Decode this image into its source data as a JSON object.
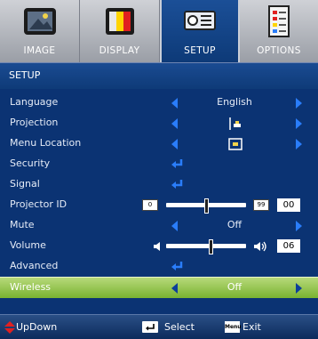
{
  "tabs": [
    {
      "label": "IMAGE",
      "icon": "image-icon"
    },
    {
      "label": "DISPLAY",
      "icon": "display-icon"
    },
    {
      "label": "SETUP",
      "icon": "projector-icon",
      "active": true
    },
    {
      "label": "OPTIONS",
      "icon": "options-icon"
    }
  ],
  "menu_title": "SETUP",
  "rows": {
    "language": {
      "label": "Language",
      "value": "English"
    },
    "projection": {
      "label": "Projection"
    },
    "menu_location": {
      "label": "Menu Location"
    },
    "security": {
      "label": "Security"
    },
    "signal": {
      "label": "Signal"
    },
    "projector_id": {
      "label": "Projector ID",
      "min": "0",
      "max": "99",
      "value": "00",
      "level": 0.5
    },
    "mute": {
      "label": "Mute",
      "value": "Off"
    },
    "volume": {
      "label": "Volume",
      "value": "06",
      "level": 0.55
    },
    "advanced": {
      "label": "Advanced"
    },
    "wireless": {
      "label": "Wireless",
      "value": "Off"
    }
  },
  "footer": {
    "updown": "UpDown",
    "select": "Select",
    "menu_badge": "Menu",
    "exit": "Exit"
  },
  "colors": {
    "panel": "#0b3373",
    "selected_row": "#8fc442",
    "arrow": "#2a7dfa",
    "tab_active": "#1b4f97"
  }
}
